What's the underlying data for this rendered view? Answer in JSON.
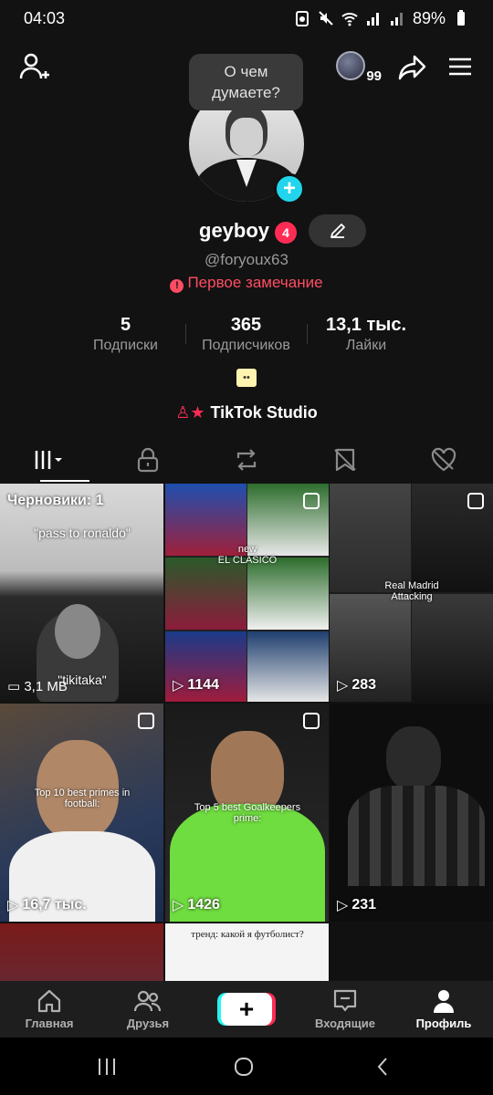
{
  "status": {
    "time": "04:03",
    "battery": "89%"
  },
  "bubble": {
    "text": "О чем думаете?"
  },
  "coins": {
    "count": "99"
  },
  "profile": {
    "username": "geyboy",
    "notifications": "4",
    "handle": "@foryoux63",
    "warning": "Первое замечание"
  },
  "stats": {
    "following": {
      "value": "5",
      "label": "Подписки"
    },
    "followers": {
      "value": "365",
      "label": "Подписчиков"
    },
    "likes": {
      "value": "13,1 тыс.",
      "label": "Лайки"
    }
  },
  "studio": {
    "label": "TikTok Studio"
  },
  "grid": {
    "drafts": {
      "label": "Черновики: 1",
      "caption1": "\"pass to ronaldo\"",
      "caption2": "\"tikitaka\"",
      "size": "3,1 MB"
    },
    "items": [
      {
        "caption": "new\nEL CLASICO",
        "views": "1144"
      },
      {
        "caption": "Real Madrid\nAttacking",
        "views": "283"
      },
      {
        "caption": "Top 10 best primes in\nfootball:",
        "views": "16,7 тыс."
      },
      {
        "caption": "Top 5 best Goalkeepers\nprime:",
        "views": "1426"
      },
      {
        "caption": "",
        "views": "231"
      },
      {
        "caption": "тренд: какой я футболист?",
        "views": ""
      }
    ]
  },
  "nav": {
    "home": "Главная",
    "friends": "Друзья",
    "inbox": "Входящие",
    "profile": "Профиль"
  }
}
